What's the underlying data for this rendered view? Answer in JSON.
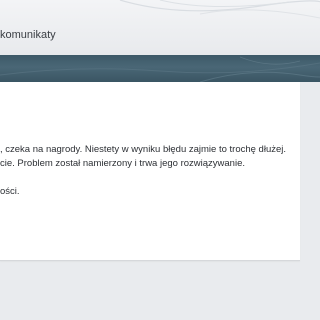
{
  "breadcrumb": {
    "current": "komunikaty"
  },
  "message": {
    "line1": ", czeka na nagrody. Niestety w wyniku błędu zajmie to trochę dłużej.",
    "line2": "cie. Problem został namierzony i trwa jego rozwiązywanie.",
    "line3": "ości."
  },
  "colors": {
    "nav_band": "#4a6776",
    "page_background": "#e9ebee",
    "card_background": "#ffffff",
    "text": "#2d3035"
  }
}
